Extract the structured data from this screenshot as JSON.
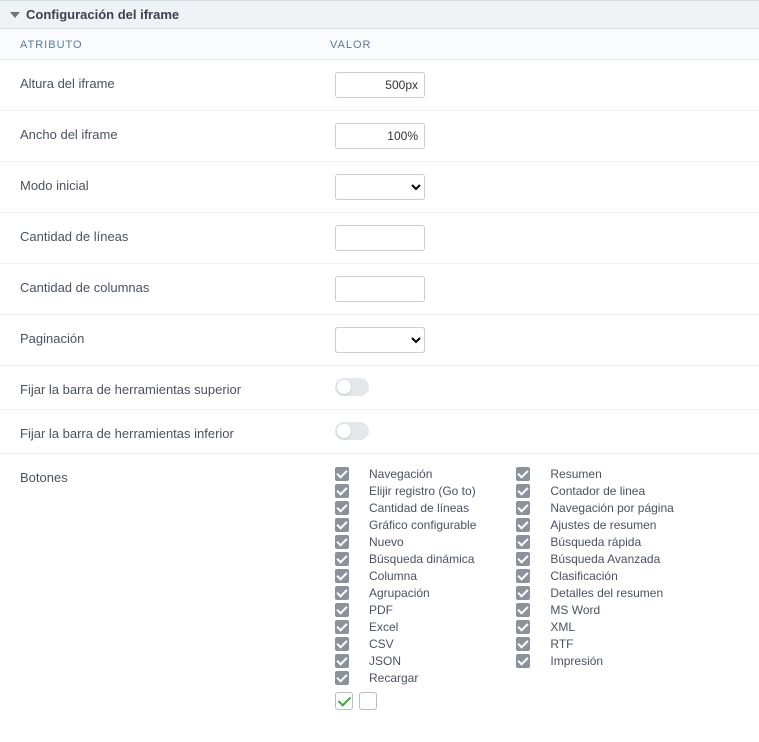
{
  "panel": {
    "title": "Configuración del iframe"
  },
  "headers": {
    "attr": "ATRIBUTO",
    "val": "VALOR"
  },
  "rows": {
    "height": {
      "label": "Altura del iframe",
      "value": "500px"
    },
    "width": {
      "label": "Ancho del iframe",
      "value": "100%"
    },
    "initmode": {
      "label": "Modo inicial",
      "value": ""
    },
    "lines": {
      "label": "Cantidad de líneas",
      "value": ""
    },
    "cols": {
      "label": "Cantidad de columnas",
      "value": ""
    },
    "pagination": {
      "label": "Paginación",
      "value": ""
    },
    "fixtop": {
      "label": "Fijar la barra de herramientas superior",
      "on": false
    },
    "fixbot": {
      "label": "Fijar la barra de herramientas inferior",
      "on": false
    },
    "buttons": {
      "label": "Botones"
    }
  },
  "buttons_left": [
    "Navegación",
    "Elijir registro (Go to)",
    "Cantidad de líneas",
    "Gráfico configurable",
    "Nuevo",
    "Búsqueda dinámica",
    "Columna",
    "Agrupación",
    "PDF",
    "Excel",
    "CSV",
    "JSON",
    "Recargar"
  ],
  "buttons_right": [
    "Resumen",
    "Contador de linea",
    "Navegación por página",
    "Ajustes de resumen",
    "Búsqueda rápida",
    "Búsqueda Avanzada",
    "Clasificación",
    "Detalles del resumen",
    "MS Word",
    "XML",
    "RTF",
    "Impresión"
  ]
}
